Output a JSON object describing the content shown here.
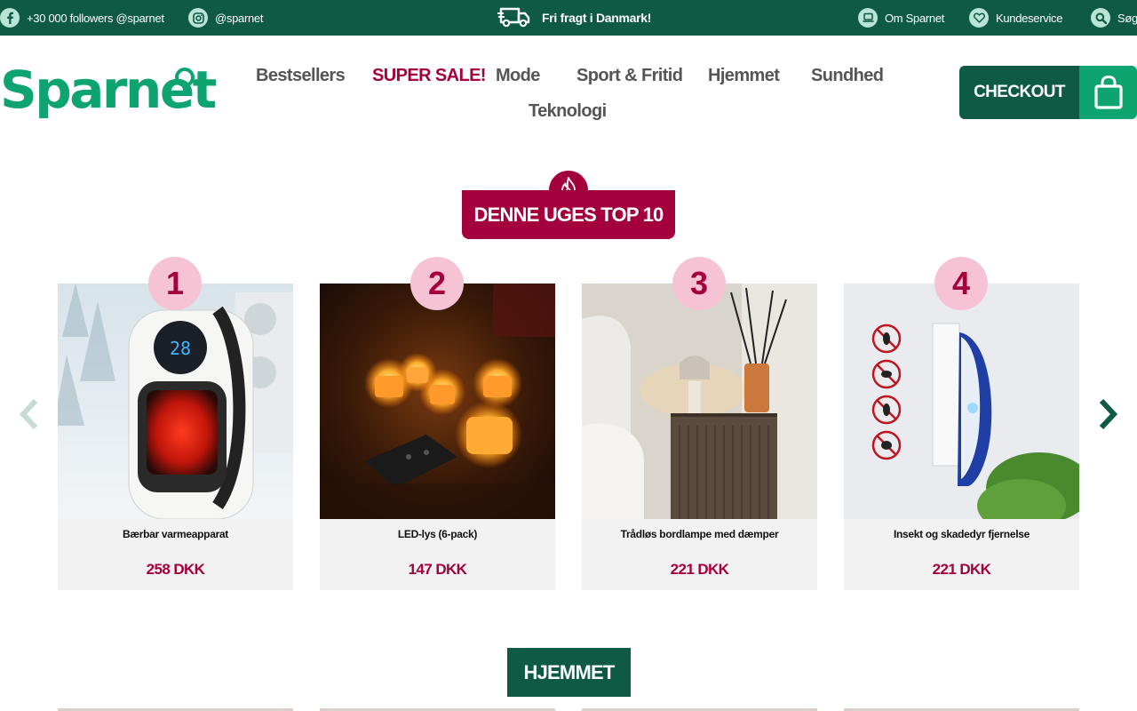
{
  "topbar": {
    "facebook": {
      "text": "+30 000 followers @sparnet",
      "icon": "facebook-icon"
    },
    "instagram": {
      "text": "@sparnet",
      "icon": "instagram-icon"
    },
    "shipping": {
      "text": "Fri fragt i Danmark!",
      "icon": "truck-icon"
    },
    "about": {
      "text": "Om Sparnet",
      "icon": "laptop-icon"
    },
    "service": {
      "text": "Kundeservice",
      "icon": "heart-icon"
    },
    "search": {
      "text": "Søg",
      "icon": "search-icon"
    }
  },
  "logo": {
    "text": "Sparnet"
  },
  "nav": {
    "items": [
      "Bestsellers",
      "SUPER SALE!",
      "Mode",
      "Sport & Fritid",
      "Hjemmet",
      "Sundhed",
      "Teknologi"
    ]
  },
  "checkout": {
    "label": "CHECKOUT",
    "icon": "shopping-bag-icon"
  },
  "top10": {
    "title": "DENNE UGES TOP 10",
    "icon": "flame-icon",
    "products": [
      {
        "rank": "1",
        "name": "Bærbar varmeapparat",
        "price": "258 DKK"
      },
      {
        "rank": "2",
        "name": "LED-lys (6-pack)",
        "price": "147 DKK"
      },
      {
        "rank": "3",
        "name": "Trådløs bordlampe med dæmper",
        "price": "221 DKK"
      },
      {
        "rank": "4",
        "name": "Insekt og skadedyr fjernelse",
        "price": "221 DKK"
      }
    ]
  },
  "hjemmet": {
    "title": "HJEMMET"
  },
  "colors": {
    "primary": "#0e5a45",
    "brand_green": "#0ea46f",
    "accent": "#a3003d",
    "rank_bg": "#f6c3d4"
  }
}
